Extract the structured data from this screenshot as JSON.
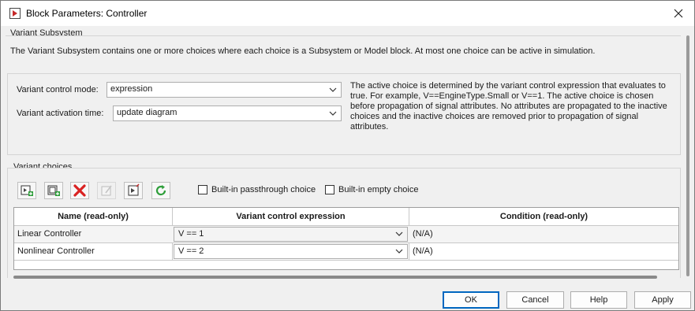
{
  "window": {
    "title": "Block Parameters: Controller"
  },
  "section": {
    "title": "Variant Subsystem",
    "description": "The Variant Subsystem contains one or more choices where each choice is a Subsystem or Model block. At most one choice can be active in simulation."
  },
  "params": {
    "mode_label": "Variant control mode:",
    "mode_value": "expression",
    "activation_label": "Variant activation time:",
    "activation_value": "update diagram",
    "info_lines": [
      "The active choice is determined by the variant control expression that evaluates to",
      "true. For example, V==EngineType.Small or V==1. The active choice is chosen",
      "before propagation of signal attributes. No attributes are propagated to the inactive",
      "choices and the inactive choices are removed prior to propagation of signal",
      "attributes."
    ]
  },
  "choices": {
    "title": "Variant choices",
    "toolbar_icons": [
      "add-subsystem-icon",
      "add-model-icon",
      "delete-icon",
      "edit-icon",
      "open-block-icon",
      "refresh-icon"
    ],
    "passthrough_label": "Built-in passthrough choice",
    "empty_label": "Built-in empty choice",
    "passthrough_checked": false,
    "empty_checked": false,
    "columns": [
      "Name (read-only)",
      "Variant control expression",
      "Condition (read-only)"
    ],
    "rows": [
      {
        "name": "Linear Controller",
        "expression": "V == 1",
        "condition": "(N/A)"
      },
      {
        "name": "Nonlinear Controller",
        "expression": "V == 2",
        "condition": "(N/A)"
      }
    ]
  },
  "buttons": {
    "ok": "OK",
    "cancel": "Cancel",
    "help": "Help",
    "apply": "Apply"
  },
  "colors": {
    "accent": "#0067c0",
    "delete": "#d92121",
    "refresh": "#2e9e3a"
  }
}
